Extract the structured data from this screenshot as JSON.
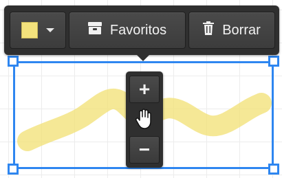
{
  "toolbar": {
    "color_swatch": "#f3e27c",
    "favorites_label": "Favoritos",
    "delete_label": "Borrar",
    "favorites_icon": "archive-box-icon",
    "delete_icon": "trash-icon"
  },
  "stroke": {
    "color": "#f3e27c",
    "opacity": 0.75
  },
  "selection": {
    "color": "#2e86f0"
  },
  "zoom": {
    "plus_label": "+",
    "minus_label": "−",
    "drag_icon": "hand-grab-icon"
  }
}
